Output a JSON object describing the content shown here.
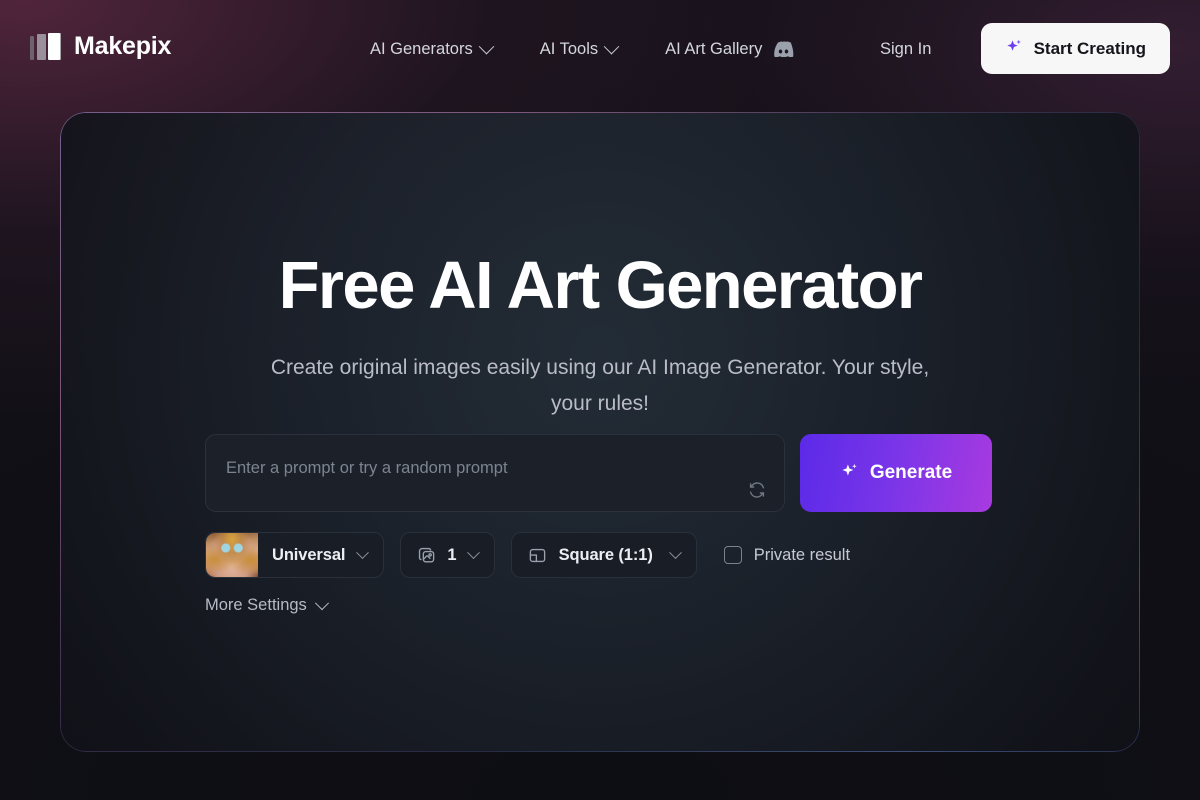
{
  "brand": {
    "name": "Makepix",
    "logo_icon": "bars-logo-icon"
  },
  "header": {
    "nav": [
      {
        "label": "AI Generators",
        "icon": "chevron-down-icon",
        "name": "nav-ai-generators"
      },
      {
        "label": "AI Tools",
        "icon": "chevron-down-icon",
        "name": "nav-ai-tools"
      },
      {
        "label": "AI Art Gallery",
        "icon": "discord-icon",
        "name": "nav-ai-art-gallery"
      },
      {
        "label": "Sign In",
        "icon": "",
        "name": "nav-sign-in"
      }
    ],
    "cta": {
      "label": "Start Creating",
      "icon": "sparkle-icon",
      "bg_color": "#f7f7f7",
      "text_color": "#17151c",
      "icon_color": "#6d3df0"
    }
  },
  "hero": {
    "title": "Free AI Art Generator",
    "subtitle": "Create original images easily using our AI Image Generator. Your style, your rules!",
    "prompt": {
      "value": "",
      "placeholder": "Enter a prompt or try a random prompt",
      "shuffle_icon": "refresh-random-icon"
    },
    "generate": {
      "label": "Generate",
      "icon": "sparkle-icon",
      "gradient_from": "#5b2ae8",
      "gradient_to": "#a83ae0"
    },
    "controls": {
      "style": {
        "label": "Universal",
        "thumbnail": "style-preview-thumbnail",
        "chevron": "chevron-down-icon"
      },
      "count": {
        "value": "1",
        "icon": "images-stack-icon",
        "chevron": "chevron-down-icon"
      },
      "ratio": {
        "label": "Square (1:1)",
        "icon": "aspect-ratio-icon",
        "chevron": "chevron-down-icon"
      },
      "private": {
        "label": "Private result",
        "checked": false
      }
    },
    "more_settings": {
      "label": "More Settings",
      "chevron": "chevron-down-icon"
    }
  }
}
